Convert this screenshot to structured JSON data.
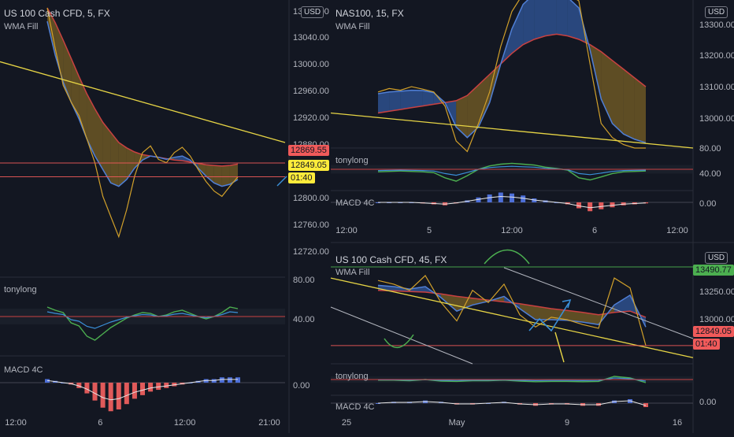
{
  "colors": {
    "background": "#131722",
    "grid": "#1e222d",
    "price": "#d1a02a",
    "wma_fast": "#4f7fd6",
    "wma_slow": "#c94141",
    "fill_up": "#3d6fc9",
    "fill_down": "#9c7a27",
    "trend": "#e6d445",
    "hline": "#f05a5a",
    "osc_green": "#4caf50",
    "osc_blue": "#3a8fd8",
    "osc_red": "#c94141",
    "macd_up": "#4d6fd8",
    "macd_down": "#e05a5a",
    "macd_signal": "#e6e6e6",
    "arrow": "#3a8fd8",
    "channel": "#b2b5be",
    "green_line": "#4caf50"
  },
  "panels": [
    {
      "id": "left",
      "title": "US 100 Cash CFD, 5, FX",
      "indicator": "WMA Fill",
      "currency": "USD",
      "osc_label": "tonylong",
      "macd_label": "MACD 4C",
      "price_ticks": [
        "13080.00",
        "13040.00",
        "13000.00",
        "12960.00",
        "12920.00",
        "12880.00",
        "12800.00",
        "12760.00",
        "12720.00"
      ],
      "osc_ticks": [
        "80.00",
        "40.00"
      ],
      "macd_ticks": [
        "0.00"
      ],
      "time_ticks": [
        "12:00",
        "6",
        "12:00",
        "21:00"
      ],
      "price_tags": [
        {
          "text": "12869.55",
          "style": "red"
        },
        {
          "text": "12849.05",
          "style": "yellow"
        },
        {
          "text": "01:40",
          "style": "yellow"
        }
      ]
    },
    {
      "id": "top-right",
      "title": "NAS100, 15, FX",
      "indicator": "WMA Fill",
      "currency": "USD",
      "osc_label": "tonylong",
      "macd_label": "MACD 4C",
      "price_ticks": [
        "13300.00",
        "13200.00",
        "13100.00",
        "13000.00"
      ],
      "osc_ticks": [
        "80.00",
        "40.00"
      ],
      "macd_ticks": [
        "0.00"
      ],
      "time_ticks": [
        "12:00",
        "5",
        "12:00",
        "6",
        "12:00"
      ]
    },
    {
      "id": "bottom-right",
      "title": "US 100 Cash CFD, 45, FX",
      "indicator": "WMA Fill",
      "currency": "USD",
      "osc_label": "tonylong",
      "macd_label": "MACD 4C",
      "price_ticks": [
        "13250.00",
        "13000.00"
      ],
      "macd_ticks": [
        "0.00"
      ],
      "time_ticks": [
        "25",
        "May",
        "9",
        "16"
      ],
      "price_tags": [
        {
          "text": "13490.77",
          "style": "green"
        },
        {
          "text": "12849.05",
          "style": "red"
        },
        {
          "text": "01:40",
          "style": "red"
        }
      ]
    }
  ],
  "chart_data": [
    {
      "type": "line",
      "title": "US 100 Cash CFD, 5, FX",
      "series_price": [
        13100,
        13040,
        12985,
        12960,
        12940,
        12905,
        12870,
        12820,
        12790,
        12760,
        12800,
        12850,
        12885,
        12895,
        12875,
        12870,
        12885,
        12893,
        12880,
        12860,
        12842,
        12828,
        12820,
        12835,
        12849
      ],
      "series_wma_fast": [
        13080,
        13030,
        12990,
        12960,
        12935,
        12905,
        12880,
        12860,
        12840,
        12835,
        12845,
        12862,
        12874,
        12880,
        12878,
        12875,
        12878,
        12880,
        12874,
        12862,
        12850,
        12840,
        12835,
        12838,
        12845
      ],
      "series_wma_slow": [
        13100,
        13078,
        13052,
        13025,
        12998,
        12972,
        12950,
        12930,
        12915,
        12900,
        12892,
        12886,
        12882,
        12880,
        12878,
        12876,
        12874,
        12873,
        12871,
        12869,
        12867,
        12866,
        12865,
        12866,
        12868
      ],
      "trend_line": [
        [
          0,
          13020
        ],
        [
          24,
          12900
        ]
      ],
      "levels": [
        12869.55,
        12849.05
      ],
      "ylim": [
        12700,
        13100
      ],
      "osc": [
        62,
        58,
        55,
        42,
        38,
        25,
        20,
        28,
        36,
        42,
        48,
        52,
        55,
        54,
        50,
        52,
        56,
        58,
        54,
        50,
        47,
        50,
        55,
        62,
        60
      ],
      "osc_ylim": [
        0,
        100
      ],
      "macd": [
        2,
        1,
        0,
        -1,
        -3,
        -6,
        -10,
        -14,
        -16,
        -15,
        -12,
        -9,
        -7,
        -5,
        -4,
        -3,
        -2,
        -1,
        0,
        1,
        2,
        2,
        3,
        3,
        3
      ],
      "macd_ylim": [
        -20,
        10
      ]
    },
    {
      "type": "line",
      "title": "NAS100, 15, FX",
      "series_price": [
        13120,
        13130,
        13125,
        13135,
        13128,
        13120,
        13080,
        12980,
        12950,
        13030,
        13120,
        13250,
        13350,
        13400,
        13420,
        13420,
        13410,
        13400,
        13380,
        13200,
        13030,
        12990,
        12970,
        12960,
        12960
      ],
      "series_wma_fast": [
        13115,
        13120,
        13122,
        13125,
        13124,
        13118,
        13090,
        13020,
        12990,
        13020,
        13090,
        13200,
        13300,
        13370,
        13400,
        13405,
        13400,
        13390,
        13360,
        13240,
        13100,
        13030,
        13000,
        12985,
        12975
      ],
      "series_wma_slow": [
        13060,
        13065,
        13070,
        13075,
        13080,
        13085,
        13090,
        13095,
        13110,
        13140,
        13170,
        13200,
        13230,
        13255,
        13270,
        13280,
        13285,
        13280,
        13270,
        13255,
        13235,
        13210,
        13185,
        13160,
        13135
      ],
      "trend_line": [
        [
          0,
          13060
        ],
        [
          24,
          12960
        ]
      ],
      "ylim": [
        12960,
        13360
      ],
      "osc": [
        44,
        45,
        46,
        45,
        44,
        42,
        30,
        22,
        35,
        50,
        58,
        62,
        64,
        62,
        60,
        55,
        52,
        48,
        30,
        25,
        32,
        40,
        44,
        45,
        46
      ],
      "osc_ylim": [
        0,
        100
      ],
      "macd": [
        0,
        0,
        0,
        0,
        -1,
        -2,
        -3,
        -1,
        2,
        5,
        8,
        10,
        9,
        7,
        4,
        2,
        0,
        -2,
        -6,
        -9,
        -7,
        -5,
        -3,
        -2,
        -1
      ],
      "macd_ylim": [
        -12,
        12
      ]
    },
    {
      "type": "line",
      "title": "US 100 Cash CFD, 45, FX",
      "series_price": [
        13380,
        13350,
        13300,
        13420,
        13200,
        13050,
        13300,
        13200,
        13350,
        13100,
        13000,
        13080,
        13060,
        13020,
        12990,
        13400,
        13320,
        12849
      ],
      "series_wma_fast": [
        13340,
        13330,
        13310,
        13330,
        13240,
        13130,
        13180,
        13210,
        13250,
        13150,
        13060,
        13060,
        13055,
        13040,
        13020,
        13180,
        13260,
        13000
      ],
      "series_wma_slow": [
        13300,
        13295,
        13290,
        13285,
        13270,
        13250,
        13235,
        13220,
        13205,
        13190,
        13170,
        13150,
        13135,
        13120,
        13100,
        13120,
        13130,
        13080
      ],
      "trend_line": [
        [
          0,
          13400
        ],
        [
          25,
          12750
        ]
      ],
      "levels": [
        13490.77,
        12849.05
      ],
      "ylim": [
        12700,
        13600
      ],
      "osc": [
        48,
        48,
        46,
        50,
        45,
        44,
        46,
        46,
        48,
        45,
        43,
        44,
        44,
        43,
        44,
        60,
        55,
        40
      ],
      "osc_ylim": [
        0,
        100
      ],
      "macd": [
        0,
        1,
        1,
        2,
        1,
        -1,
        -1,
        0,
        1,
        -1,
        -2,
        -1,
        -1,
        -2,
        -2,
        2,
        3,
        -3
      ],
      "macd_ylim": [
        -6,
        6
      ]
    }
  ]
}
